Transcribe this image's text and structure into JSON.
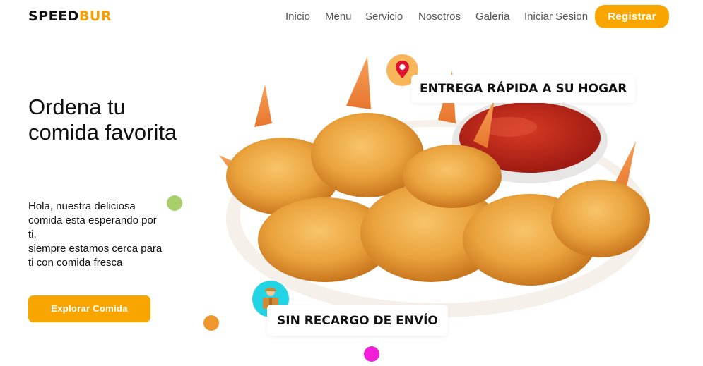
{
  "header": {
    "logo_part1": "SPEED",
    "logo_part2": "BUR",
    "nav": [
      "Inicio",
      "Menu",
      "Servicio",
      "Nosotros",
      "Galeria",
      "Iniciar Sesion"
    ],
    "register_label": "Registrar"
  },
  "hero": {
    "title": "Ordena tu comida favorita",
    "description_lines": [
      "Hola, nuestra deliciosa comida esta esperando por ti,",
      "siempre estamos cerca para ti con comida fresca"
    ],
    "cta_label": "Explorar Comida"
  },
  "badges": {
    "delivery": "ENTREGA RÁPIDA A SU HOGAR",
    "no_fee": "SIN RECARGO DE ENVÍO"
  },
  "icons": {
    "location": "location-pin-icon",
    "courier": "delivery-person-icon"
  },
  "colors": {
    "accent": "#f9a500",
    "dot_green": "#a8cf6a",
    "dot_orange": "#f0962e",
    "dot_magenta": "#f21fd8",
    "pin_circle": "#f7b65a",
    "courier_circle": "#22d4e4"
  }
}
